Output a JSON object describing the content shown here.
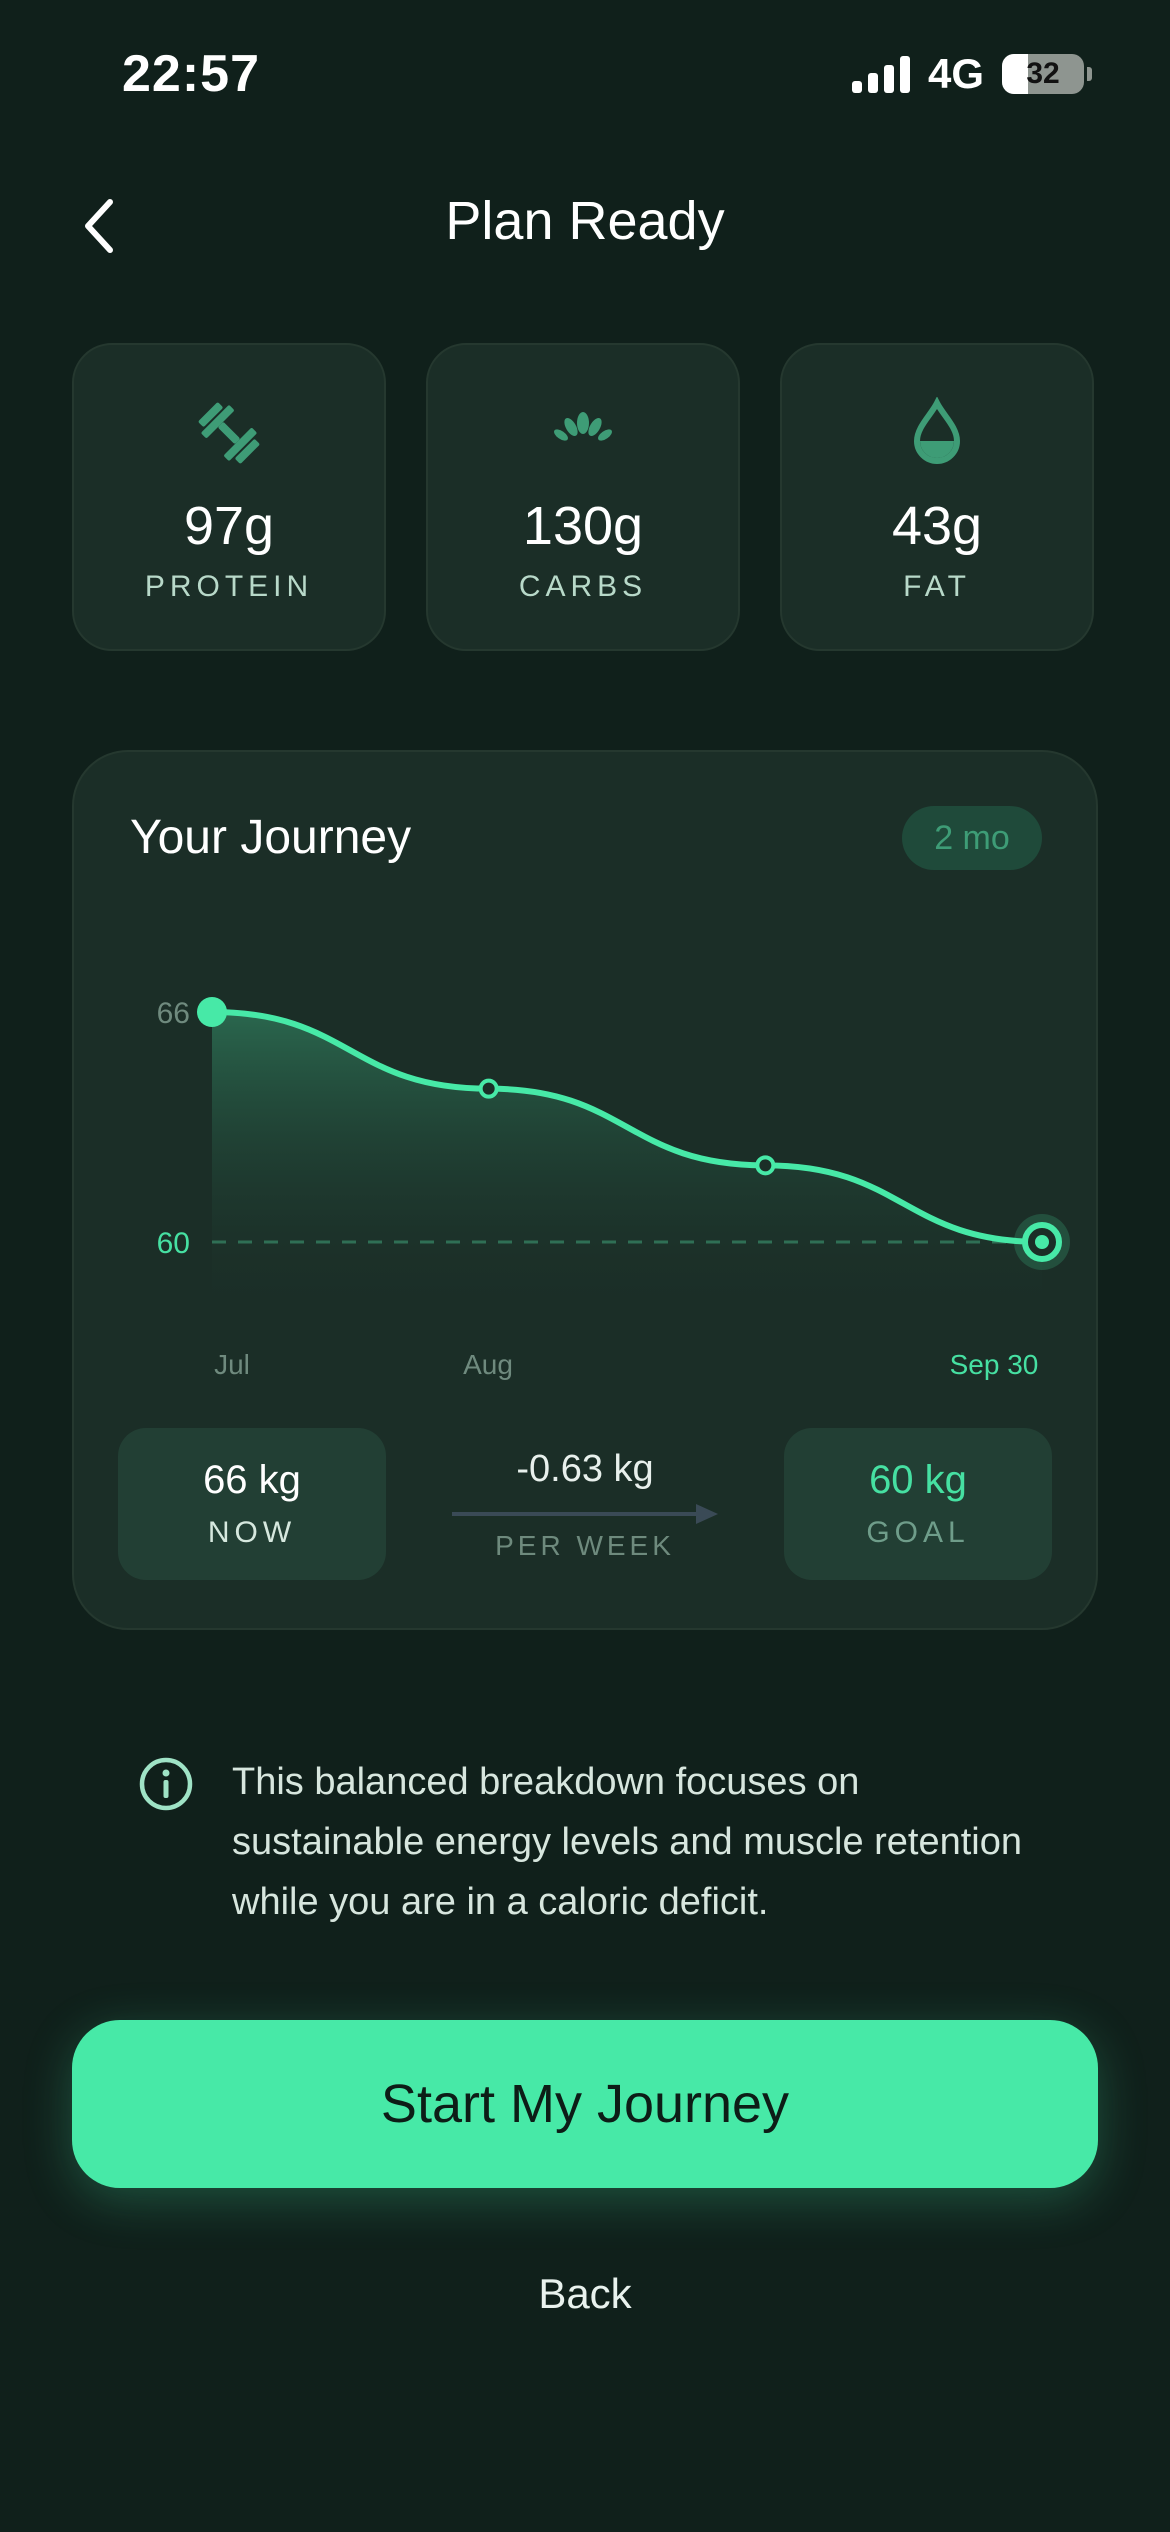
{
  "status_bar": {
    "time": "22:57",
    "network": "4G",
    "battery": "32"
  },
  "header": {
    "title": "Plan Ready",
    "back_icon": "chevron-left-icon"
  },
  "macros": [
    {
      "value": "97g",
      "label": "PROTEIN",
      "icon": "dumbbell-icon"
    },
    {
      "value": "130g",
      "label": "CARBS",
      "icon": "grain-icon"
    },
    {
      "value": "43g",
      "label": "FAT",
      "icon": "droplet-icon"
    }
  ],
  "journey": {
    "title": "Your Journey",
    "duration": "2 mo",
    "now": {
      "value": "66 kg",
      "label": "NOW"
    },
    "rate": {
      "value": "-0.63 kg",
      "label": "PER WEEK"
    },
    "goal": {
      "value": "60 kg",
      "label": "GOAL"
    }
  },
  "chart_data": {
    "type": "area",
    "x": [
      "Jul",
      "Aug",
      "",
      "Sep 30"
    ],
    "values": [
      66,
      64,
      62,
      60
    ],
    "x_tick_labels": [
      "Jul",
      "Aug",
      "Sep 30"
    ],
    "y_tick_labels": [
      "66",
      "60"
    ],
    "goal_line": 60,
    "ylim": [
      59,
      66
    ],
    "grid": false
  },
  "info": {
    "icon": "info-icon",
    "text": "This balanced breakdown focuses on sustainable energy levels and muscle retention while you are in a caloric deficit."
  },
  "cta": {
    "label": "Start My Journey"
  },
  "back_link": {
    "label": "Back"
  },
  "colors": {
    "background": "#10201b",
    "card": "#1b2e27",
    "accent": "#47e9a7",
    "icon_muted": "#3e9c76"
  }
}
